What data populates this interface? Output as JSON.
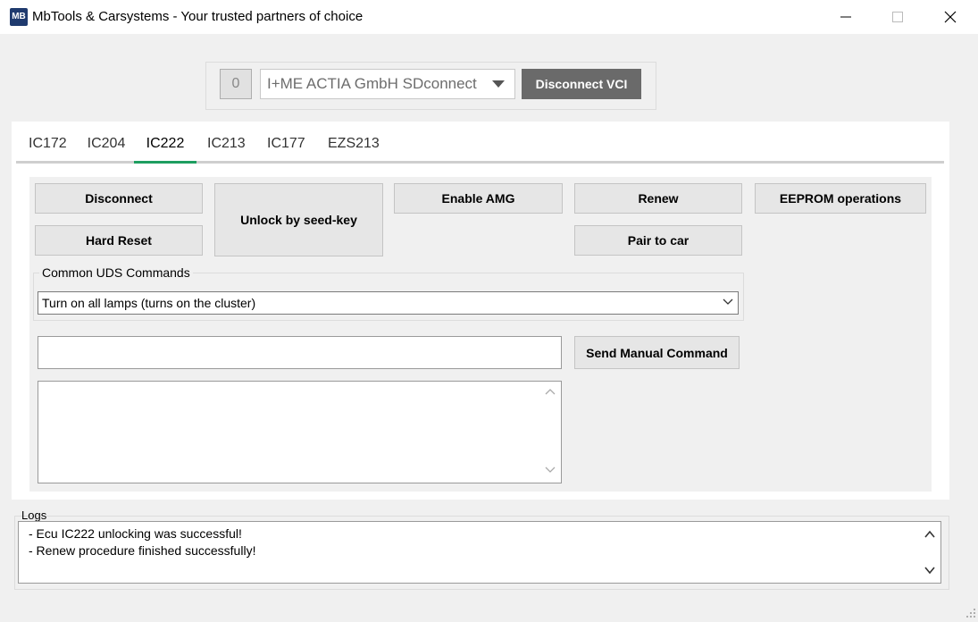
{
  "window": {
    "icon_text": "MB",
    "title": "MbTools & Carsystems - Your trusted partners of choice"
  },
  "connection": {
    "count": "0",
    "vci_device": "I+ME ACTIA GmbH SDconnect",
    "disconnect_vci_label": "Disconnect VCI"
  },
  "tabs": [
    {
      "label": "IC172"
    },
    {
      "label": "IC204"
    },
    {
      "label": "IC222",
      "active": true
    },
    {
      "label": "IC213"
    },
    {
      "label": "IC177"
    },
    {
      "label": "EZS213"
    }
  ],
  "buttons": {
    "disconnect": "Disconnect",
    "hard_reset": "Hard Reset",
    "unlock": "Unlock by seed-key",
    "enable_amg": "Enable AMG",
    "renew": "Renew",
    "pair_to_car": "Pair to car",
    "eeprom": "EEPROM operations",
    "send_manual": "Send Manual Command"
  },
  "uds": {
    "group_label": "Common UDS Commands",
    "selected": "Turn on all lamps (turns on the cluster)"
  },
  "manual_command": {
    "value": "",
    "response": ""
  },
  "logs": {
    "label": "Logs",
    "lines": [
      " - Ecu IC222 unlocking was successful!",
      " - Renew procedure finished successfully!"
    ]
  },
  "colors": {
    "accent_tab": "#1e9e60",
    "disconnect_vci_bg": "#6a6a6a",
    "app_icon_bg": "#1f3a6e"
  }
}
